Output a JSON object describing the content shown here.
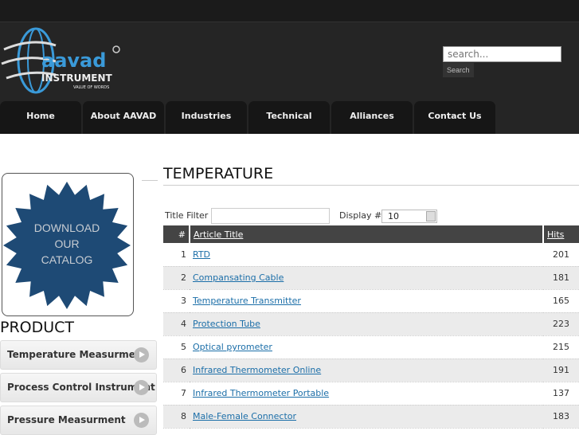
{
  "logo": {
    "brand": "aavad",
    "line1": "INSTRUMENT",
    "tagline": "VALUE OF WORDS"
  },
  "search": {
    "placeholder": "search...",
    "button": "Search"
  },
  "nav": [
    "Home",
    "About AAVAD",
    "Industries",
    "Technical",
    "Alliances",
    "Contact Us"
  ],
  "sidebar": {
    "catalog": [
      "DOWNLOAD",
      "OUR",
      "CATALOG"
    ],
    "heading": "PRODUCT",
    "items": [
      "Temperature Measurment",
      "Process Control Instrument",
      "Pressure Measurment"
    ]
  },
  "main": {
    "title": "TEMPERATURE",
    "filter_label": "Title Filter",
    "display_label": "Display #",
    "display_value": "10",
    "columns": [
      "#",
      "Article Title",
      "Hits"
    ],
    "rows": [
      [
        "1",
        "RTD",
        "201"
      ],
      [
        "2",
        "Compansating Cable",
        "181"
      ],
      [
        "3",
        "Temperature Transmitter",
        "165"
      ],
      [
        "4",
        "Protection Tube",
        "223"
      ],
      [
        "5",
        "Optical pyrometer",
        "215"
      ],
      [
        "6",
        "Infrared Thermometer Online",
        "191"
      ],
      [
        "7",
        "Infrared Thermometer Portable",
        "137"
      ],
      [
        "8",
        "Male-Female Connector",
        "183"
      ]
    ]
  },
  "colors": {
    "accent": "#3a9ad9",
    "header_bg": "#252525",
    "table_header": "#444444",
    "link": "#1b6ea8"
  }
}
